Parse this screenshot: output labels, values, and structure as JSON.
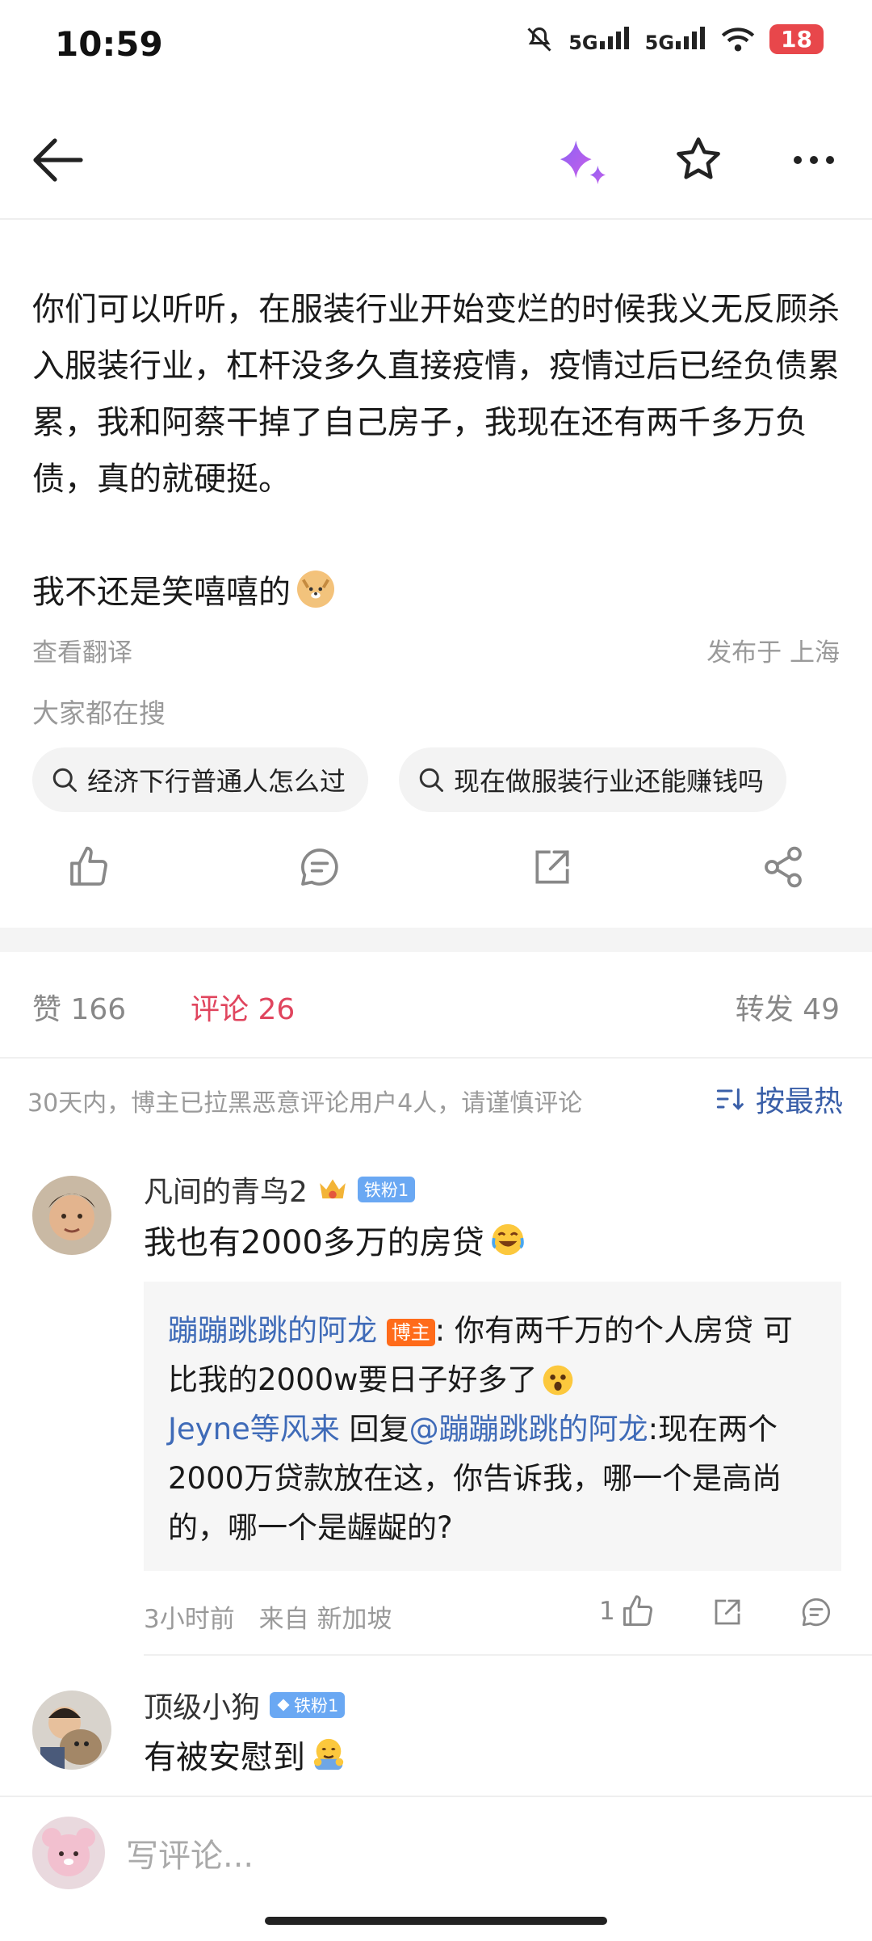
{
  "status_bar": {
    "time": "10:59",
    "network_1": "5G",
    "network_2": "5G",
    "battery": "18"
  },
  "header": {
    "back_icon": "arrow-left-icon",
    "ai_icon": "sparkle-icon",
    "favorite_icon": "star-icon",
    "more_icon": "more-dots-icon"
  },
  "post": {
    "text": "你们可以听听，在服装行业开始变烂的时候我义无反顾杀入服装行业，杠杆没多久直接疫情，疫情过后已经负债累累，我和阿蔡干掉了自己房子，我现在还有两千多万负债，真的就硬挺。",
    "text_2": "我不还是笑嘻嘻的",
    "translate": "查看翻译",
    "location": "发布于 上海",
    "search_label": "大家都在搜",
    "search_chips": [
      "经济下行普通人怎么过",
      "现在做服装行业还能赚钱吗"
    ]
  },
  "tabs": {
    "likes": "赞 166",
    "comments": "评论 26",
    "reposts": "转发 49"
  },
  "comments_header": {
    "notice": "30天内，博主已拉黑恶意评论用户4人，请谨慎评论",
    "sort": "按最热"
  },
  "comments": [
    {
      "username": "凡间的青鸟2",
      "badge": "铁粉1",
      "text": "我也有2000多万的房贷",
      "replies": [
        {
          "user": "蹦蹦跳跳的阿龙",
          "tag": "博主",
          "text_1": ": 你有两千万的个人房贷 可",
          "text_2": "比我的2000w要日子好多了"
        },
        {
          "user": "Jeyne等风来",
          "reply_word": " 回复",
          "mention": "@蹦蹦跳跳的阿龙",
          "text_1": ":现在两个",
          "text_2": "2000万贷款放在这，你告诉我，哪一个是高尚",
          "text_3": "的，哪一个是龌龊的?"
        }
      ],
      "time": "3小时前",
      "source": "来自 新加坡",
      "like_count": "1"
    },
    {
      "username": "顶级小狗",
      "badge": "铁粉1",
      "text": "有被安慰到"
    }
  ],
  "bottom": {
    "placeholder": "写评论..."
  }
}
